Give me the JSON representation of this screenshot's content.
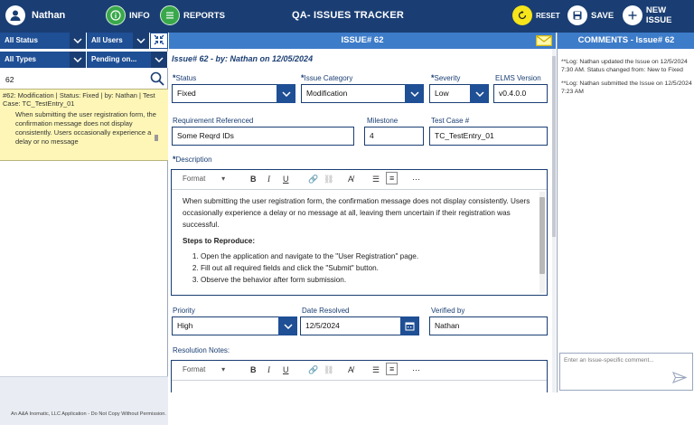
{
  "topbar": {
    "user": "Nathan",
    "info_label": "INFO",
    "reports_label": "REPORTS",
    "title": "QA- ISSUES TRACKER",
    "reset_label": "RESET",
    "save_label": "SAVE",
    "new_issue_label": "NEW ISSUE"
  },
  "filters": {
    "status": "All Status",
    "users": "All Users",
    "types": "All Types",
    "pending": "Pending on..."
  },
  "search": {
    "value": "62"
  },
  "results": [
    {
      "header": "#62: Modification | Status: Fixed | by: Nathan | Test Case: TC_TestEntry_01",
      "desc": "When submitting the user registration form, the confirmation message does not display consistently. Users occasionally experience a delay or no message"
    }
  ],
  "left_footer": "An A&A Inomatic, LLC Application - Do Not Copy Without Permission.",
  "issue": {
    "header": "ISSUE# 62",
    "by": "Issue# 62 - by: Nathan on 12/05/2024",
    "status_label": "Status",
    "status": "Fixed",
    "category_label": "Issue Category",
    "category": "Modification",
    "severity_label": "Severity",
    "severity": "Low",
    "elms_label": "ELMS Version",
    "elms": "v0.4.0.0",
    "req_label": "Requirement Referenced",
    "req": "Some Reqrd IDs",
    "milestone_label": "Milestone",
    "milestone": "4",
    "testcase_label": "Test Case #",
    "testcase": "TC_TestEntry_01",
    "desc_label": "Description",
    "format_label": "Format",
    "desc_p1": "When submitting the user registration form, the confirmation message does not display consistently. Users occasionally experience a delay or no message at all, leaving them uncertain if their registration was successful.",
    "steps_label": "Steps to Reproduce:",
    "steps": [
      "Open the application and navigate to the \"User Registration\" page.",
      "Fill out all required fields and click the \"Submit\" button.",
      "Observe the behavior after form submission."
    ],
    "priority_label": "Priority",
    "priority": "High",
    "date_label": "Date Resolved",
    "date": "12/5/2024",
    "verified_label": "Verified by",
    "verified": "Nathan",
    "resolution_label": "Resolution Notes:"
  },
  "comments": {
    "header": "COMMENTS - Issue# 62",
    "logs": [
      "**Log: Nathan updated the Issue on 12/5/2024 7:30 AM. Status changed from: New to Fixed",
      "**Log: Nathan submitted the Issue on 12/5/2024 7:23 AM"
    ],
    "placeholder": "Enter an Issue-specific comment..."
  },
  "colors": {
    "nav": "#1a3e73",
    "accent": "#3d7cc9",
    "result_bg": "#fdf6b6"
  }
}
